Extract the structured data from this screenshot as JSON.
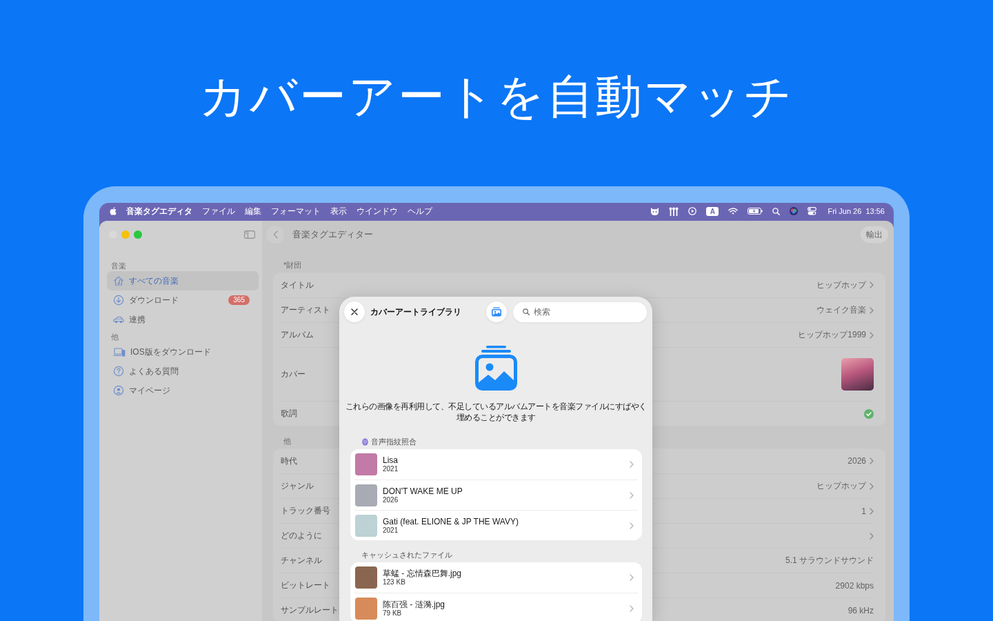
{
  "headline": "カバーアートを自動マッチ",
  "menu_bar": {
    "app_name": "音楽タグエディタ",
    "menus": [
      "ファイル",
      "編集",
      "フォーマット",
      "表示",
      "ウインドウ",
      "ヘルプ"
    ],
    "input_source": "A",
    "clock": "Fri Jun 26  13:56"
  },
  "sidebar": {
    "sections": [
      {
        "title": "音楽",
        "items": [
          {
            "kind": "music",
            "label": "すべての音楽",
            "selected": true
          },
          {
            "kind": "download",
            "label": "ダウンロード",
            "selected": false,
            "badge": "365"
          },
          {
            "kind": "car",
            "label": "連携",
            "selected": false
          }
        ]
      },
      {
        "title": "他",
        "items": [
          {
            "kind": "devices",
            "label": "IOS版をダウンロード",
            "selected": false
          },
          {
            "kind": "help",
            "label": "よくある質問",
            "selected": false
          },
          {
            "kind": "account",
            "label": "マイページ",
            "selected": false
          }
        ]
      }
    ]
  },
  "toolbar": {
    "title": "音楽タグエディター",
    "export_button": "輸出"
  },
  "sections": [
    {
      "title": "*財団",
      "rows": [
        {
          "kind": "text",
          "label": "タイトル",
          "value": "ヒップホップ",
          "chevron": true
        },
        {
          "kind": "text",
          "label": "アーティスト",
          "value": "ウェイク音楽",
          "chevron": true
        },
        {
          "kind": "text",
          "label": "アルバム",
          "value": "ヒップホップ1999",
          "chevron": true
        },
        {
          "kind": "cover",
          "label": "カバー"
        },
        {
          "kind": "status",
          "label": "歌詞",
          "checked": true
        }
      ]
    },
    {
      "title": "他",
      "rows": [
        {
          "kind": "text",
          "label": "時代",
          "value": "2026",
          "chevron": true
        },
        {
          "kind": "text",
          "label": "ジャンル",
          "value": "ヒップホップ",
          "chevron": true
        },
        {
          "kind": "text",
          "label": "トラック番号",
          "value": "1",
          "chevron": true
        },
        {
          "kind": "text",
          "label": "どのように",
          "chevron": true
        },
        {
          "kind": "text",
          "label": "チャンネル",
          "value": "5.1 サラウンドサウンド",
          "chevron": false
        },
        {
          "kind": "text",
          "label": "ビットレート",
          "value": "2902 kbps",
          "chevron": false
        },
        {
          "kind": "text",
          "label": "サンプルレート",
          "value": "96 kHz",
          "chevron": false
        }
      ]
    }
  ],
  "modal": {
    "title": "カバーアートライブラリ",
    "search": {
      "placeholder": "検索"
    },
    "description": "これらの画像を再利用して、不足しているアルバムアートを音楽ファイルにすばやく埋めることができます",
    "groups": [
      {
        "kind": "fingerprint",
        "title": "音声指紋照合",
        "items": [
          {
            "title": "Lisa",
            "subtitle": "2021",
            "color": "#c27aa6"
          },
          {
            "title": "DON'T WAKE ME UP",
            "subtitle": "2026",
            "color": "#a8abb3"
          },
          {
            "title": "Gati (feat. ELIONE & JP THE WAVY)",
            "subtitle": "2021",
            "color": "#bcd2d4"
          }
        ]
      },
      {
        "kind": "files",
        "title": "キャッシュされたファイル",
        "items": [
          {
            "title": "草蜢 - 忘情森巴舞.jpg",
            "subtitle": "123 KB",
            "color": "#8a6650"
          },
          {
            "title": "陈百强 - 涟漪.jpg",
            "subtitle": "79 KB",
            "color": "#d88b5a"
          }
        ]
      }
    ]
  }
}
